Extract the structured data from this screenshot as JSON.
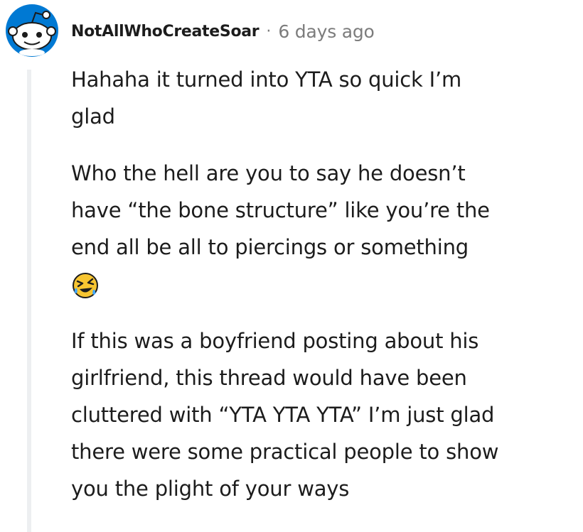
{
  "comment": {
    "author": "NotAllWhoCreateSoar",
    "separator": "·",
    "timestamp": "6 days ago",
    "paragraphs": [
      {
        "line1": "Hahaha it turned into YTA so quick I’m",
        "line2": "glad"
      },
      {
        "line1": "Who the hell are you to say he doesn’t",
        "line2": "have “the bone structure” like you’re the",
        "line3": "end all be all to piercings or something"
      },
      {
        "line1": "If this was a boyfriend posting about his",
        "line2": "girlfriend, this thread would have been",
        "line3": "cluttered with “YTA YTA YTA” I’m just glad",
        "line4": "there were some practical people to show",
        "line5": "you the plight of your ways"
      }
    ],
    "emoji": "rolling-on-floor-laughing-icon"
  },
  "colors": {
    "text": "#1c1c1c",
    "meta": "#7c7c7c",
    "thread_line": "#edeff1",
    "avatar_bg": "#0079d3",
    "emoji_yellow": "#f7c531"
  }
}
